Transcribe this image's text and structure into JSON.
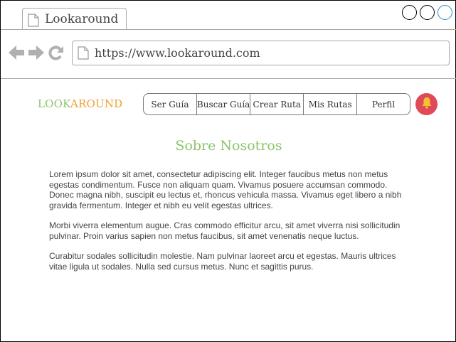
{
  "browser": {
    "tab_title": "Lookaround",
    "url": "https://www.lookaround.com"
  },
  "header": {
    "logo_part1": "LOOK",
    "logo_part2": "AROUND",
    "nav_items": [
      "Ser Guía",
      "Buscar Guía",
      "Crear Ruta",
      "Mis Rutas",
      "Perfil"
    ]
  },
  "main": {
    "title": "Sobre Nosotros",
    "paragraphs": [
      "Lorem ipsum dolor sit amet, consectetur adipiscing elit. Integer faucibus metus non metus egestas condimentum. Fusce non aliquam quam. Vivamus posuere accumsan commodo. Donec magna nibh, suscipit eu lectus et, rhoncus vehicula massa. Vivamus eget libero a nibh gravida fermentum. Integer et nibh eu velit egestas ultrices.",
      "Morbi viverra elementum augue. Cras commodo efficitur arcu, sit amet viverra nisi sollicitudin pulvinar. Proin varius sapien non metus faucibus, sit amet venenatis neque luctus.",
      "Curabitur sodales sollicitudin molestie. Nam pulvinar laoreet arcu et egestas. Mauris ultrices vitae ligula ut sodales. Nulla sed cursus metus. Nunc et sagittis purus."
    ]
  },
  "icons": {
    "tab": "document-icon",
    "back": "back-arrow-icon",
    "forward": "forward-arrow-icon",
    "reload": "reload-icon",
    "notifications": "bell-icon"
  },
  "colors": {
    "logo_green": "#8cc56a",
    "logo_orange": "#f0a030",
    "title_green": "#8cc56a",
    "bell_bg": "#e04a58",
    "bell_icon": "#f2c230"
  }
}
